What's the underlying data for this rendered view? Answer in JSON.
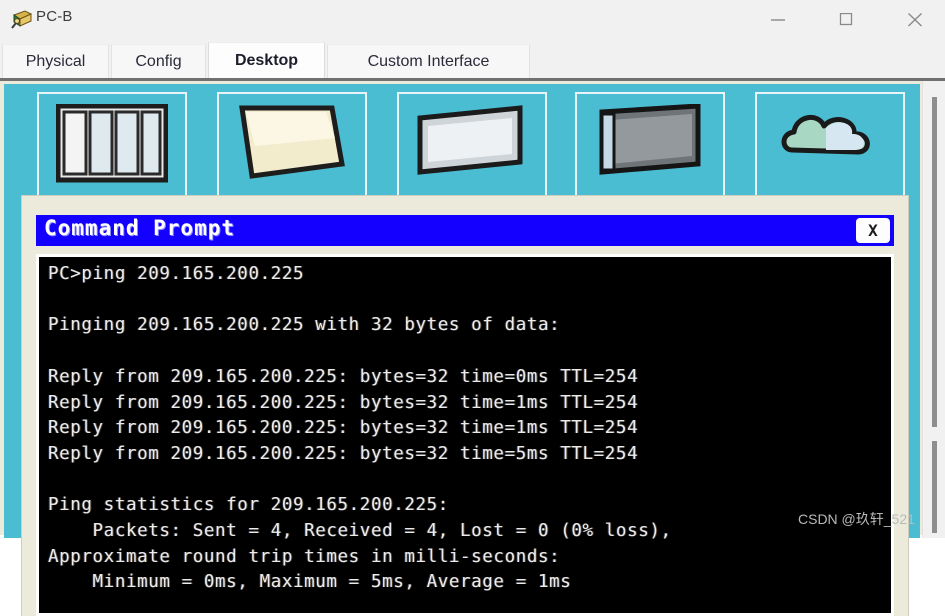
{
  "window": {
    "title": "PC-B",
    "icon": "pc-device-icon",
    "controls": [
      {
        "name": "minimize-button",
        "glyph": "minimize-icon",
        "label": "—"
      },
      {
        "name": "maximize-button",
        "glyph": "maximize-icon",
        "label": "☐"
      },
      {
        "name": "close-button",
        "glyph": "close-icon",
        "label": "✕"
      }
    ]
  },
  "tabs": [
    {
      "label": "Physical",
      "active": false
    },
    {
      "label": "Config",
      "active": false
    },
    {
      "label": "Desktop",
      "active": true
    },
    {
      "label": "Custom Interface",
      "active": false
    }
  ],
  "desktop": {
    "background_color": "#4bbdd2",
    "icons": [
      {
        "name": "desktop-icon-ip-configuration",
        "art": "window-panes-icon"
      },
      {
        "name": "desktop-icon-dial-up",
        "art": "document-page-icon"
      },
      {
        "name": "desktop-icon-terminal",
        "art": "flat-screen-icon"
      },
      {
        "name": "desktop-icon-command-prompt",
        "art": "monitor-icon"
      },
      {
        "name": "desktop-icon-web-browser",
        "art": "cloud-globe-icon"
      }
    ]
  },
  "scrollbar": {
    "name": "vertical-scrollbar",
    "orientation": "vertical"
  },
  "command_prompt": {
    "title": "Command Prompt",
    "title_bar_color": "#1400ff",
    "close_label": "X",
    "terminal_bg": "#000000",
    "terminal_fg": "#ebebeb",
    "prompt": "PC>",
    "command": "ping 209.165.200.225",
    "target_ip": "209.165.200.225",
    "output_lines": [
      "PC>ping 209.165.200.225",
      "",
      "Pinging 209.165.200.225 with 32 bytes of data:",
      "",
      "Reply from 209.165.200.225: bytes=32 time=0ms TTL=254",
      "Reply from 209.165.200.225: bytes=32 time=1ms TTL=254",
      "Reply from 209.165.200.225: bytes=32 time=1ms TTL=254",
      "Reply from 209.165.200.225: bytes=32 time=5ms TTL=254",
      "",
      "Ping statistics for 209.165.200.225:",
      "    Packets: Sent = 4, Received = 4, Lost = 0 (0% loss),",
      "Approximate round trip times in milli-seconds:",
      "    Minimum = 0ms, Maximum = 5ms, Average = 1ms"
    ],
    "output_text": "PC>ping 209.165.200.225\n\nPinging 209.165.200.225 with 32 bytes of data:\n\nReply from 209.165.200.225: bytes=32 time=0ms TTL=254\nReply from 209.165.200.225: bytes=32 time=1ms TTL=254\nReply from 209.165.200.225: bytes=32 time=1ms TTL=254\nReply from 209.165.200.225: bytes=32 time=5ms TTL=254\n\nPing statistics for 209.165.200.225:\n    Packets: Sent = 4, Received = 4, Lost = 0 (0% loss),\nApproximate round trip times in milli-seconds:\n    Minimum = 0ms, Maximum = 5ms, Average = 1ms",
    "stats": {
      "packets_sent": 4,
      "packets_received": 4,
      "packets_lost": 0,
      "loss_percent": "0%",
      "bytes": 32,
      "ttl": 254,
      "times_ms": [
        0,
        1,
        1,
        5
      ],
      "minimum_ms": "0ms",
      "maximum_ms": "5ms",
      "average_ms": "1ms"
    }
  },
  "watermark": "CSDN @玖轩_521"
}
